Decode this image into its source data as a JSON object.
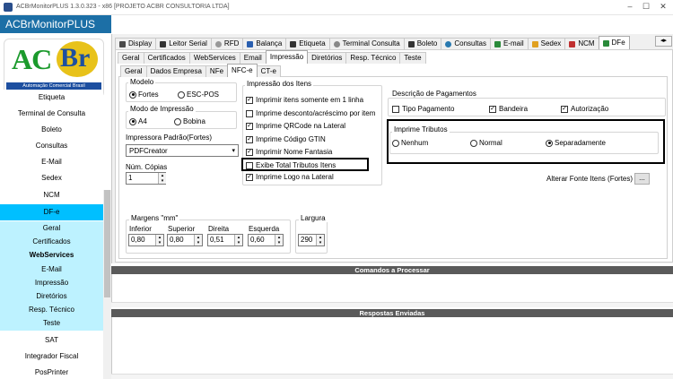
{
  "window": {
    "title": "ACBrMonitorPLUS 1.3.0.323 - x86  [PROJETO ACBR CONSULTORIA LTDA]",
    "minimize": "–",
    "maximize": "☐",
    "close": "✕"
  },
  "sidebar": {
    "app_title": "ACBrMonitorPLUS",
    "logo": {
      "part1": "AC",
      "part2": "Br",
      "band": "Automação Comercial Brasil",
      "green": "#1b9a2c",
      "blue": "#1d4fa0",
      "yellow": "#e8c21a"
    },
    "items": [
      {
        "label": "Etiqueta"
      },
      {
        "label": "Terminal de Consulta"
      },
      {
        "label": "Boleto"
      },
      {
        "label": "Consultas"
      },
      {
        "label": "E-Mail"
      },
      {
        "label": "Sedex"
      },
      {
        "label": "NCM"
      }
    ],
    "selected": "DF-e",
    "subitems": [
      {
        "label": "Geral"
      },
      {
        "label": "Certificados"
      },
      {
        "label": "WebServices"
      },
      {
        "label": "E-Mail"
      },
      {
        "label": "Impressão"
      },
      {
        "label": "Diretórios"
      },
      {
        "label": "Resp. Técnico"
      },
      {
        "label": "Teste"
      }
    ],
    "after": [
      {
        "label": "SAT"
      },
      {
        "label": "Integrador Fiscal"
      },
      {
        "label": "PosPrinter"
      }
    ],
    "accent": "#00bfff",
    "sub_bg": "#bdf2ff"
  },
  "top_tabs": [
    {
      "label": "Display",
      "icon": "display-icon",
      "color": "#4a4a4a"
    },
    {
      "label": "Leitor Serial",
      "icon": "barcode-icon",
      "color": "#333"
    },
    {
      "label": "RFD",
      "icon": "disk-icon",
      "color": "#777"
    },
    {
      "label": "Balança",
      "icon": "scale-icon",
      "color": "#2a5fb0"
    },
    {
      "label": "Etiqueta",
      "icon": "label-icon",
      "color": "#333"
    },
    {
      "label": "Terminal Consulta",
      "icon": "terminal-icon",
      "color": "#777"
    },
    {
      "label": "Boleto",
      "icon": "barcode-icon",
      "color": "#333"
    },
    {
      "label": "Consultas",
      "icon": "globe-icon",
      "color": "#2a7ab0"
    },
    {
      "label": "E-mail",
      "icon": "mail-icon",
      "color": "#2a8a3a"
    },
    {
      "label": "Sedex",
      "icon": "sedex-icon",
      "color": "#e0a020"
    },
    {
      "label": "NCM",
      "icon": "ncm-icon",
      "color": "#c03030"
    },
    {
      "label": "DFe",
      "icon": "dfe-icon",
      "color": "#2a8a3a"
    }
  ],
  "second_tabs": [
    "Geral",
    "Certificados",
    "WebServices",
    "Email",
    "Impressão",
    "Diretórios",
    "Resp. Técnico",
    "Teste"
  ],
  "third_tabs": [
    "Geral",
    "Dados Empresa",
    "NFe",
    "NFC-e",
    "CT-e"
  ],
  "form": {
    "modelo": {
      "title": "Modelo",
      "opt1": "Fortes",
      "opt2": "ESC-POS"
    },
    "modo": {
      "title": "Modo de Impressão",
      "opt1": "A4",
      "opt2": "Bobina"
    },
    "impressora": {
      "label": "Impressora Padrão(Fortes)",
      "value": "PDFCreator"
    },
    "copias": {
      "label": "Núm. Cópias",
      "value": "1"
    },
    "itens": {
      "title": "Impressão dos Itens",
      "options": [
        {
          "label": "Imprimir itens somente em 1 linha",
          "checked": true
        },
        {
          "label": "Imprime desconto/acréscimo por item",
          "checked": false
        },
        {
          "label": "Imprime QRCode na Lateral",
          "checked": true
        },
        {
          "label": "Imprime Código GTIN",
          "checked": true
        },
        {
          "label": "Imprimir Nome Fantasia",
          "checked": true
        },
        {
          "label": "Exibe Total Tributos Itens",
          "checked": false
        },
        {
          "label": "Imprime Logo na Lateral",
          "checked": true
        }
      ]
    },
    "pagamentos": {
      "title": "Descrição de Pagamentos",
      "opt1": "Tipo Pagamento",
      "opt2": "Bandeira",
      "opt3": "Autorização"
    },
    "tributos": {
      "title": "Imprime Tributos",
      "opt1": "Nenhum",
      "opt2": "Normal",
      "opt3": "Separadamente"
    },
    "fonte_label": "Alterar Fonte Itens (Fortes)",
    "fonte_btn": "...",
    "margens": {
      "title": "Margens \"mm\"",
      "fields": [
        {
          "label": "Inferior",
          "value": "0,80"
        },
        {
          "label": "Superior",
          "value": "0,80"
        },
        {
          "label": "Direita",
          "value": "0,51"
        },
        {
          "label": "Esquerda",
          "value": "0,60"
        }
      ]
    },
    "largura": {
      "title": "Largura",
      "value": "290"
    }
  },
  "bottom": {
    "cmd_title": "Comandos a Processar",
    "resp_title": "Respostas Enviadas"
  }
}
